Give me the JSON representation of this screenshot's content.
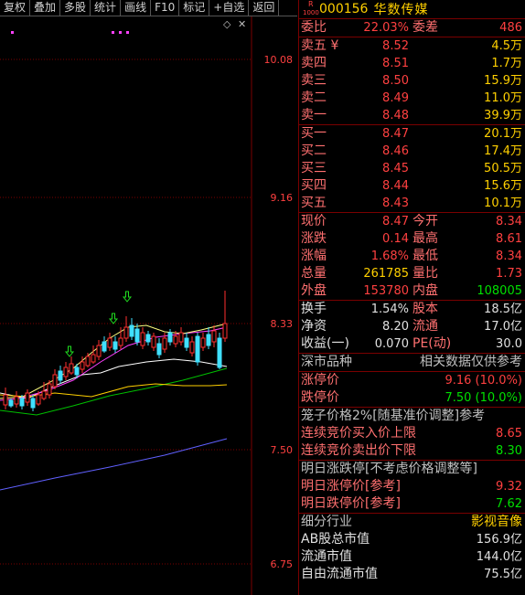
{
  "toolbar": [
    "复权",
    "叠加",
    "多股",
    "统计",
    "画线",
    "F10",
    "标记",
    "+自选",
    "返回"
  ],
  "chart": {
    "price_labels": [
      "10.08",
      "9.16",
      "8.33",
      "7.50",
      "6.75"
    ],
    "colors": {
      "up": "#ff3030",
      "down": "#40e0ff",
      "ma5": "#ffffff",
      "ma10": "#ffd000",
      "ma20": "#ff40ff",
      "ma30": "#00c000",
      "ma60": "#6060ff",
      "grid": "#7a0000"
    },
    "markers_note": "green arrows"
  },
  "quote": {
    "badge_letter": "R",
    "badge_num": "1000",
    "code": "000156",
    "name": "华数传媒",
    "weibi_label": "委比",
    "weibi_value": "22.03%",
    "weicha_label": "委差",
    "weicha_value": "486",
    "sell": [
      {
        "label": "卖五 ¥",
        "price": "8.52",
        "vol": "4.5万"
      },
      {
        "label": "卖四",
        "price": "8.51",
        "vol": "1.7万"
      },
      {
        "label": "卖三",
        "price": "8.50",
        "vol": "15.9万"
      },
      {
        "label": "卖二",
        "price": "8.49",
        "vol": "11.0万"
      },
      {
        "label": "卖一",
        "price": "8.48",
        "vol": "39.9万"
      }
    ],
    "buy": [
      {
        "label": "买一",
        "price": "8.47",
        "vol": "20.1万"
      },
      {
        "label": "买二",
        "price": "8.46",
        "vol": "17.4万"
      },
      {
        "label": "买三",
        "price": "8.45",
        "vol": "50.5万"
      },
      {
        "label": "买四",
        "price": "8.44",
        "vol": "15.6万"
      },
      {
        "label": "买五",
        "price": "8.43",
        "vol": "10.1万"
      }
    ],
    "stats": [
      {
        "l1": "现价",
        "v1": "8.47",
        "l2": "今开",
        "v2": "8.34"
      },
      {
        "l1": "涨跌",
        "v1": "0.14",
        "l2": "最高",
        "v2": "8.61"
      },
      {
        "l1": "涨幅",
        "v1": "1.68%",
        "l2": "最低",
        "v2": "8.34"
      },
      {
        "l1": "总量",
        "v1": "261785",
        "l2": "量比",
        "v2": "1.73"
      },
      {
        "l1": "外盘",
        "v1": "153780",
        "l2": "内盘",
        "v2": "108005"
      }
    ],
    "stats2": [
      {
        "l1": "换手",
        "v1": "1.54%",
        "l2": "股本",
        "v2": "18.5亿"
      },
      {
        "l1": "净资",
        "v1": "8.20",
        "l2": "流通",
        "v2": "17.0亿"
      },
      {
        "l1": "收益(一)",
        "v1": "0.070",
        "l2": "PE(动)",
        "v2": "30.0"
      }
    ],
    "market_label": "深市品种",
    "market_note": "相关数据仅供参考",
    "limit_up_label": "涨停价",
    "limit_up_value": "9.16 (10.0%)",
    "limit_down_label": "跌停价",
    "limit_down_value": "7.50 (10.0%)",
    "cage_title": "笼子价格2%[随基准价调整]参考",
    "cage_buy_label": "连续竞价买入价上限",
    "cage_buy_value": "8.65",
    "cage_sell_label": "连续竞价卖出价下限",
    "cage_sell_value": "8.30",
    "next_title": "明日涨跌停[不考虑价格调整等]",
    "next_up_label": "明日涨停价[参考]",
    "next_up_value": "9.32",
    "next_down_label": "明日跌停价[参考]",
    "next_down_value": "7.62",
    "industry_label": "细分行业",
    "industry_value": "影视音像",
    "ab_label": "AB股总市值",
    "ab_value": "156.9亿",
    "float_label": "流通市值",
    "float_value": "144.0亿",
    "free_label": "自由流通市值",
    "free_value": "75.5亿"
  }
}
